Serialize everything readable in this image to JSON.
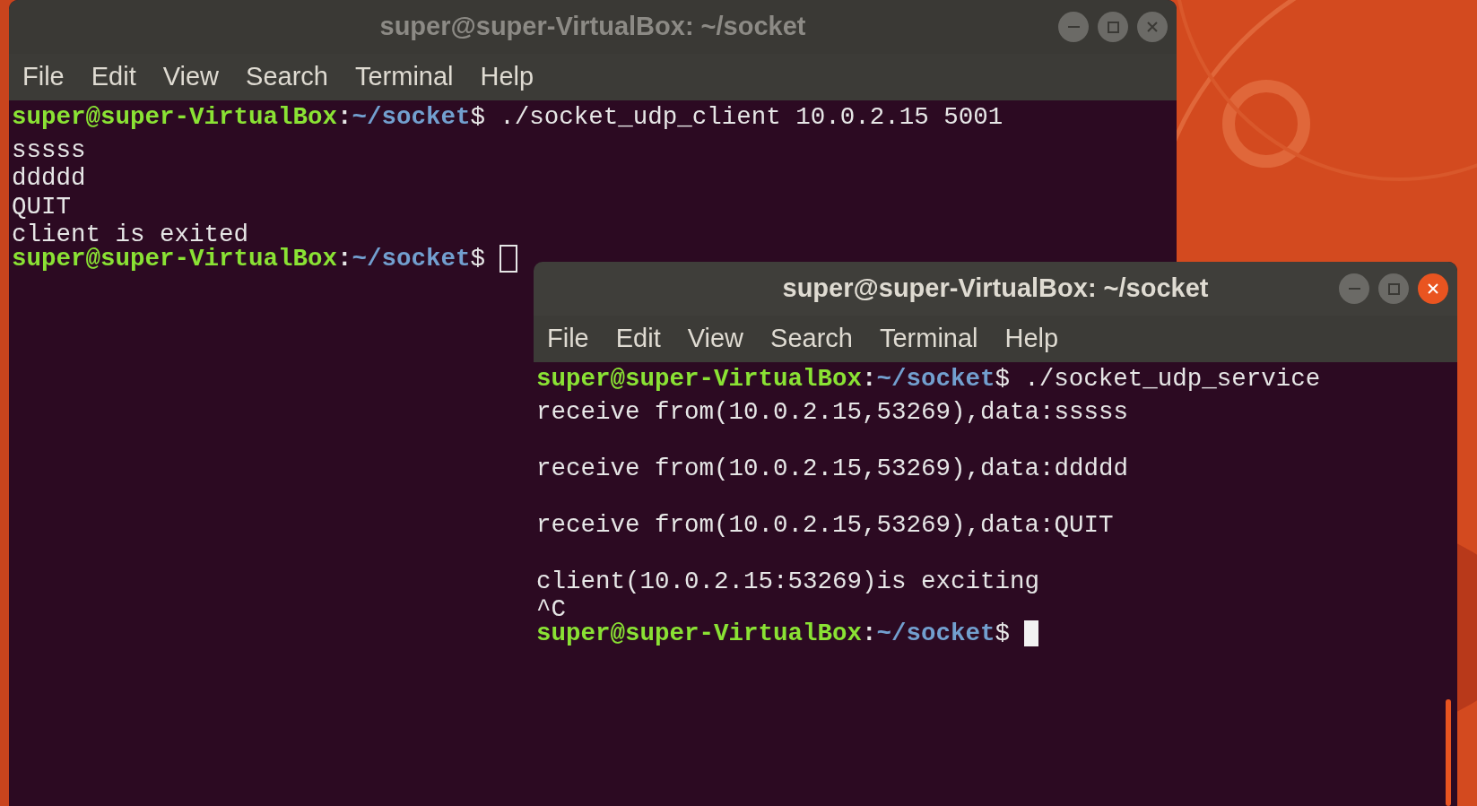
{
  "windows": [
    {
      "title": "super@super-VirtualBox: ~/socket",
      "focused": false,
      "menu": [
        "File",
        "Edit",
        "View",
        "Search",
        "Terminal",
        "Help"
      ],
      "lines": [
        {
          "kind": "prompt",
          "user": "super@super-VirtualBox",
          "colon": ":",
          "path": "~/socket",
          "dollar": "$",
          "command": "./socket_udp_client 10.0.2.15 5001"
        },
        {
          "kind": "output",
          "text": "sssss"
        },
        {
          "kind": "output",
          "text": "ddddd"
        },
        {
          "kind": "output",
          "text": "QUIT"
        },
        {
          "kind": "output",
          "text": "client is exited"
        },
        {
          "kind": "prompt",
          "user": "super@super-VirtualBox",
          "colon": ":",
          "path": "~/socket",
          "dollar": "$",
          "cursor": true
        }
      ]
    },
    {
      "title": "super@super-VirtualBox: ~/socket",
      "focused": true,
      "menu": [
        "File",
        "Edit",
        "View",
        "Search",
        "Terminal",
        "Help"
      ],
      "lines": [
        {
          "kind": "prompt",
          "user": "super@super-VirtualBox",
          "colon": ":",
          "path": "~/socket",
          "dollar": "$",
          "command": "./socket_udp_service"
        },
        {
          "kind": "output",
          "text": "receive from(10.0.2.15,53269),data:sssss"
        },
        {
          "kind": "blank"
        },
        {
          "kind": "output",
          "text": "receive from(10.0.2.15,53269),data:ddddd"
        },
        {
          "kind": "blank"
        },
        {
          "kind": "output",
          "text": "receive from(10.0.2.15,53269),data:QUIT"
        },
        {
          "kind": "blank"
        },
        {
          "kind": "output",
          "text": "client(10.0.2.15:53269)is exciting"
        },
        {
          "kind": "output",
          "text": "^C"
        },
        {
          "kind": "prompt",
          "user": "super@super-VirtualBox",
          "colon": ":",
          "path": "~/socket",
          "dollar": "$",
          "cursor": true
        }
      ]
    }
  ]
}
